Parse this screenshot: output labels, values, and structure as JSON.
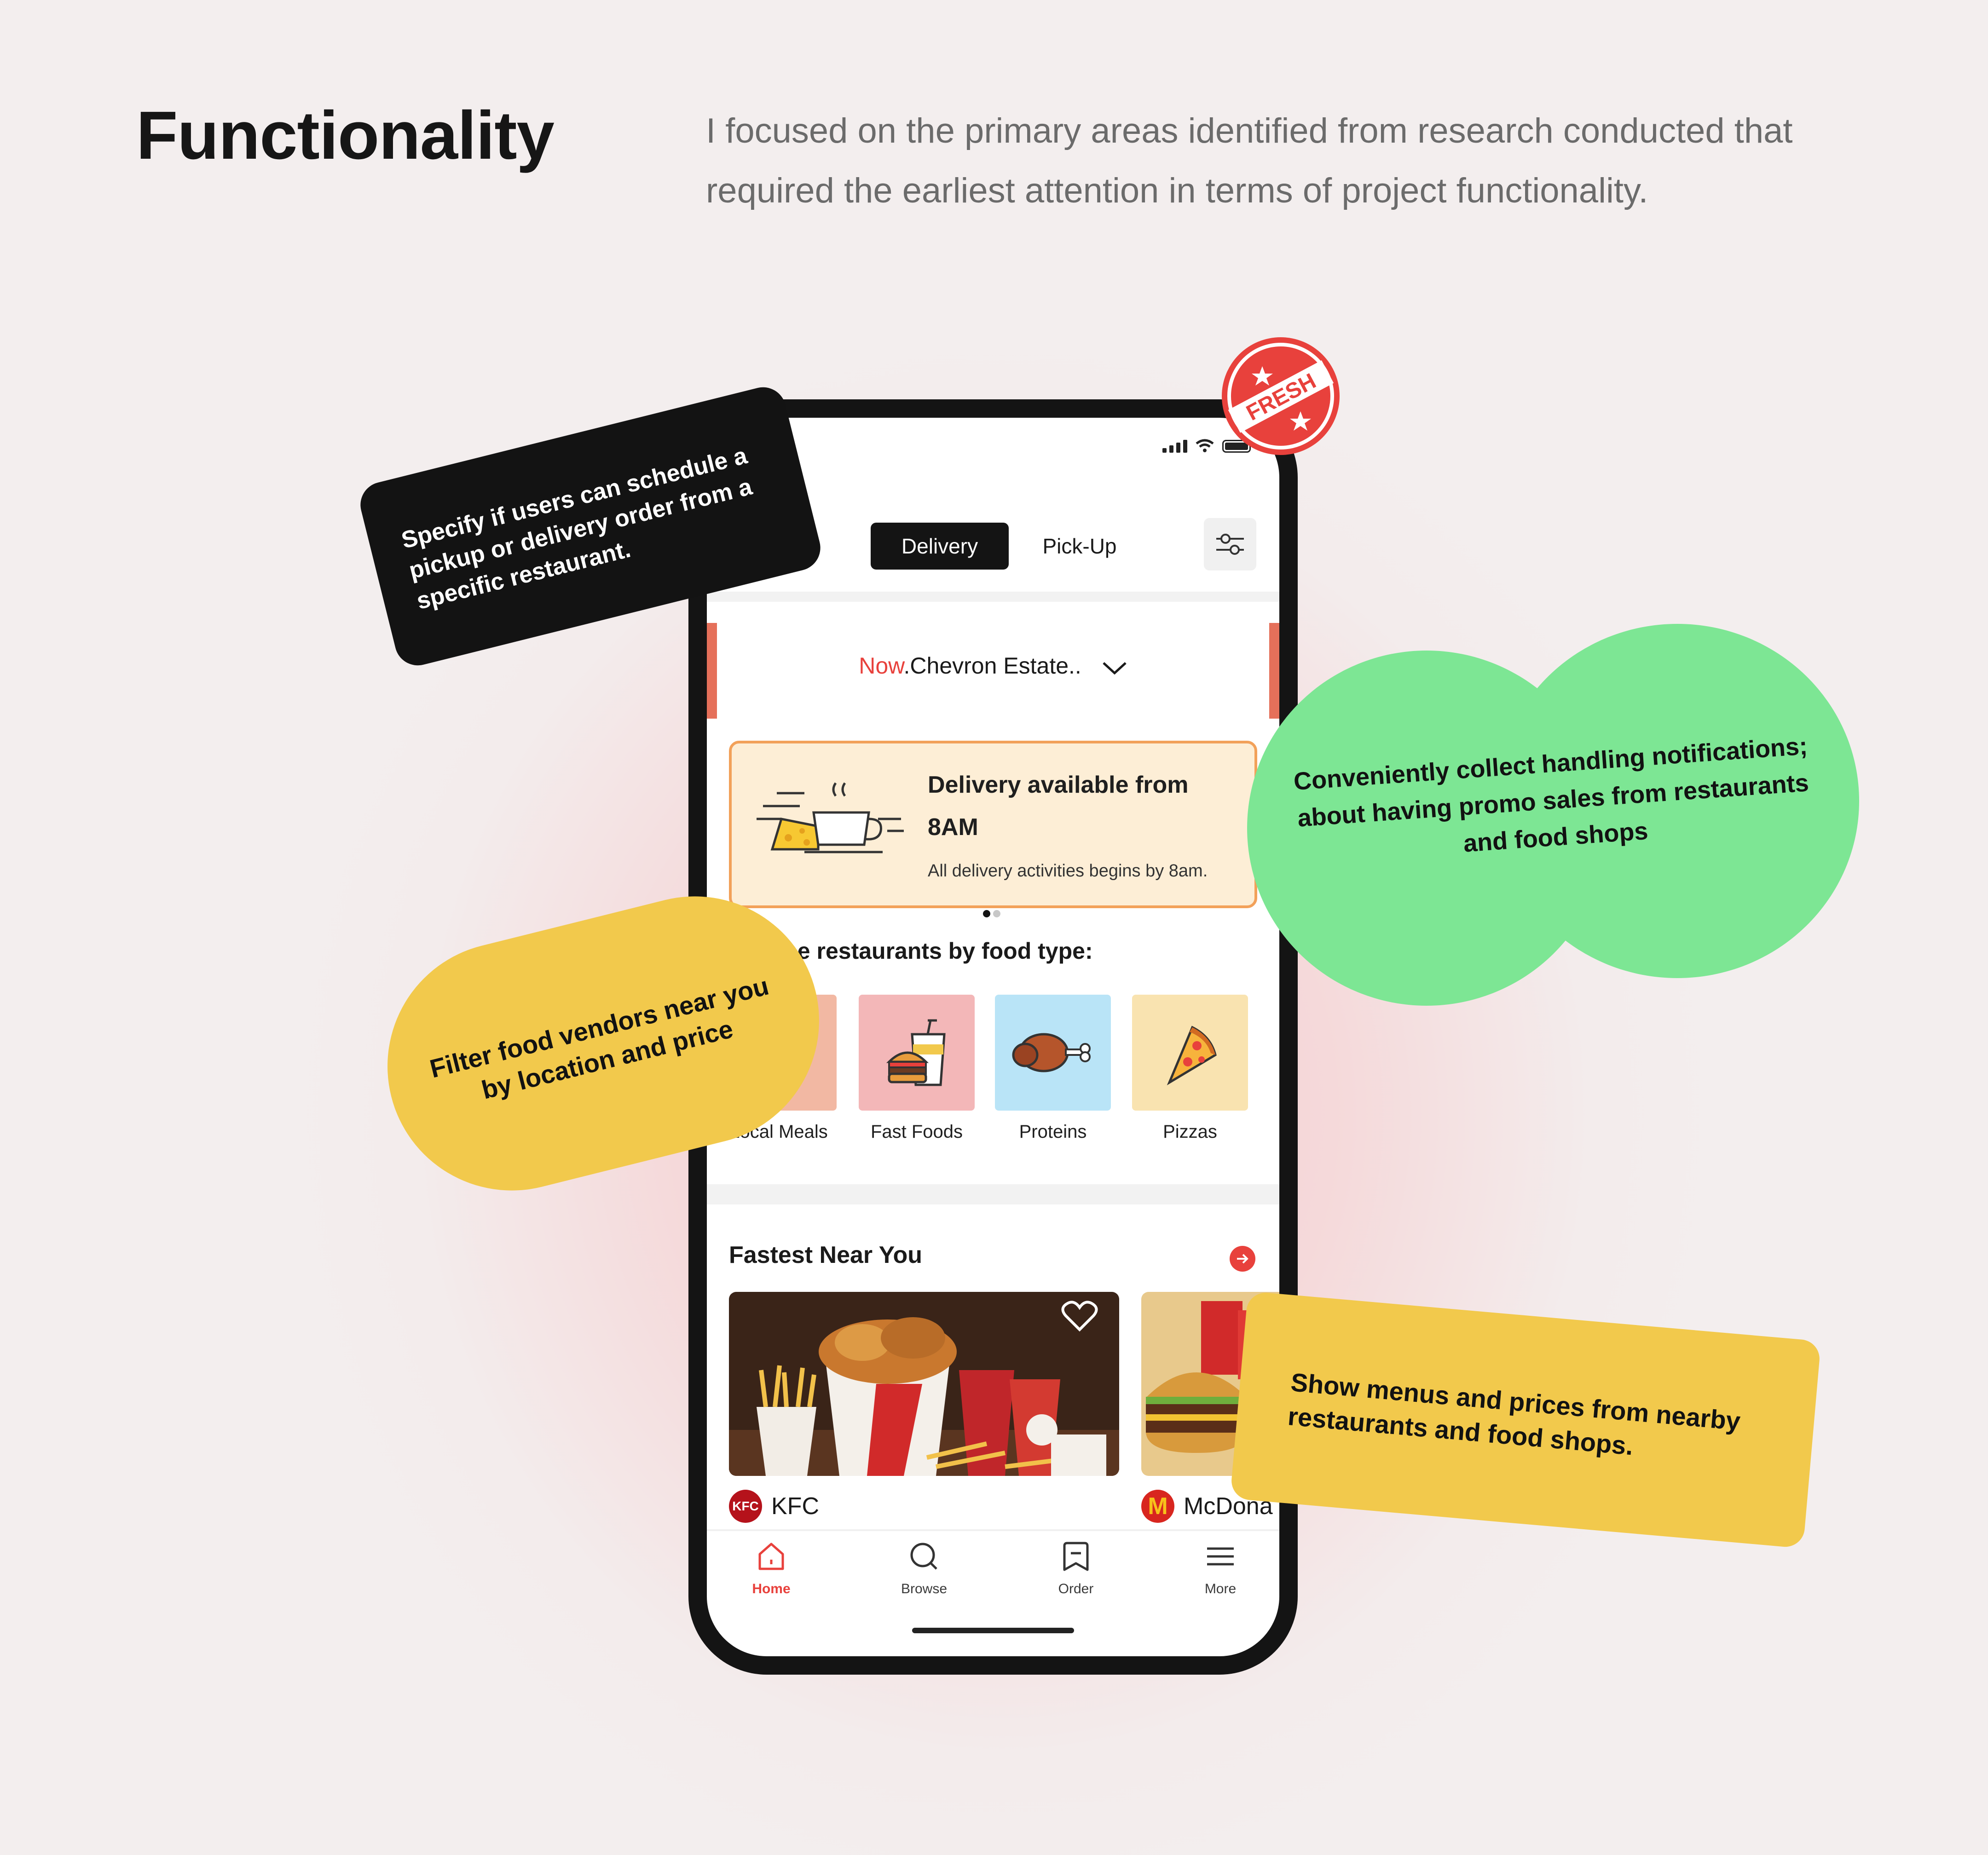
{
  "header": {
    "title": "Functionality",
    "intro": "I focused on the primary areas identified from research conducted that required the earliest attention in terms of project functionality."
  },
  "badge": {
    "text": "FRESH"
  },
  "app": {
    "tabs": [
      {
        "label": "Delivery",
        "active": true
      },
      {
        "label": "Pick-Up",
        "active": false
      }
    ],
    "location": {
      "now": "Now",
      "address": ".Chevron Estate.."
    },
    "promo": {
      "title_line1": "Delivery available from",
      "title_line2": "8AM",
      "subtitle": "All delivery activities begins by 8am."
    },
    "browse_title": "Browse restaurants by food type:",
    "categories": [
      {
        "label": "Local Meals",
        "color": "#f2b8a3"
      },
      {
        "label": "Fast Foods",
        "color": "#f3b7b8"
      },
      {
        "label": "Proteins",
        "color": "#b9e4f7"
      },
      {
        "label": "Pizzas",
        "color": "#f9e3b0"
      }
    ],
    "fastest": {
      "title": "Fastest Near You",
      "restaurants": [
        {
          "name": "KFC",
          "logo_text": "KFC"
        },
        {
          "name": "McDona",
          "logo_text": "M"
        }
      ]
    },
    "nav": [
      {
        "label": "Home",
        "icon": "home-icon",
        "active": true
      },
      {
        "label": "Browse",
        "icon": "search-icon",
        "active": false
      },
      {
        "label": "Order",
        "icon": "order-icon",
        "active": false
      },
      {
        "label": "More",
        "icon": "menu-icon",
        "active": false
      }
    ]
  },
  "notes": {
    "schedule": "Specify if users can schedule a pickup or delivery order from a specific restaurant.",
    "notifications": "Conveniently collect handling notifications; about having promo sales from restaurants and food shops",
    "filter": "Filter food vendors near you by location and price",
    "menus": "Show menus and prices from nearby restaurants and food shops."
  },
  "colors": {
    "accent_red": "#e8413c",
    "green_note": "#7de694",
    "yellow_note": "#f2c94c",
    "promo_bg": "#fdeed6",
    "promo_border": "#f2a15a"
  }
}
